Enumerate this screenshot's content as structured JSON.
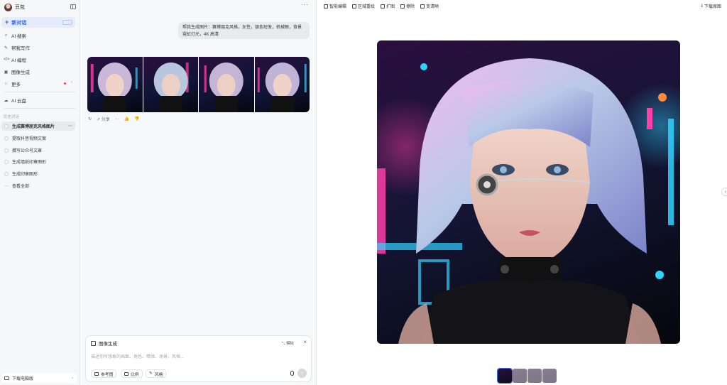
{
  "sidebar": {
    "app_name": "豆包",
    "new_chat": "新对话",
    "nav": [
      {
        "icon": "search-icon",
        "label": "AI 搜索"
      },
      {
        "icon": "pen-icon",
        "label": "帮我写作"
      },
      {
        "icon": "code-icon",
        "label": "AI 编程"
      },
      {
        "icon": "image-icon",
        "label": "图像生成"
      },
      {
        "icon": "grid-icon",
        "label": "更多"
      }
    ],
    "cloud": "AI 云盘",
    "history_label": "历史对话",
    "history": [
      {
        "label": "生成赛博朋克风格图片"
      },
      {
        "label": "提取抖音视频文案"
      },
      {
        "label": "撰写公众号文章"
      },
      {
        "label": "生成墙纸印章图形"
      },
      {
        "label": "生成印章图形"
      }
    ],
    "view_all": "查看全部",
    "download_pc": "下载电脑版"
  },
  "chat": {
    "user_message": "帮我生成图片：赛博朋克风格，女性，银色短发，机械眼，背景霓虹灯光，4K 高清",
    "share_label": "分享",
    "composer": {
      "title": "图像生成",
      "mode_label": "模板",
      "placeholder": "描述你所想象的画面、角色、情绪、场景、风格...",
      "chips": [
        "参考图",
        "比例",
        "风格"
      ]
    }
  },
  "viewer": {
    "tools": [
      "智能编辑",
      "区域重绘",
      "扩图",
      "擦除",
      "变清晰"
    ],
    "download_original": "下载原图"
  },
  "colors": {
    "accent": "#2e63e0",
    "sidebar_bg": "#f6f7f9",
    "chat_bg": "#f7f8fa",
    "neon_pink": "#ff3fa8",
    "neon_cyan": "#2fd3ff"
  }
}
